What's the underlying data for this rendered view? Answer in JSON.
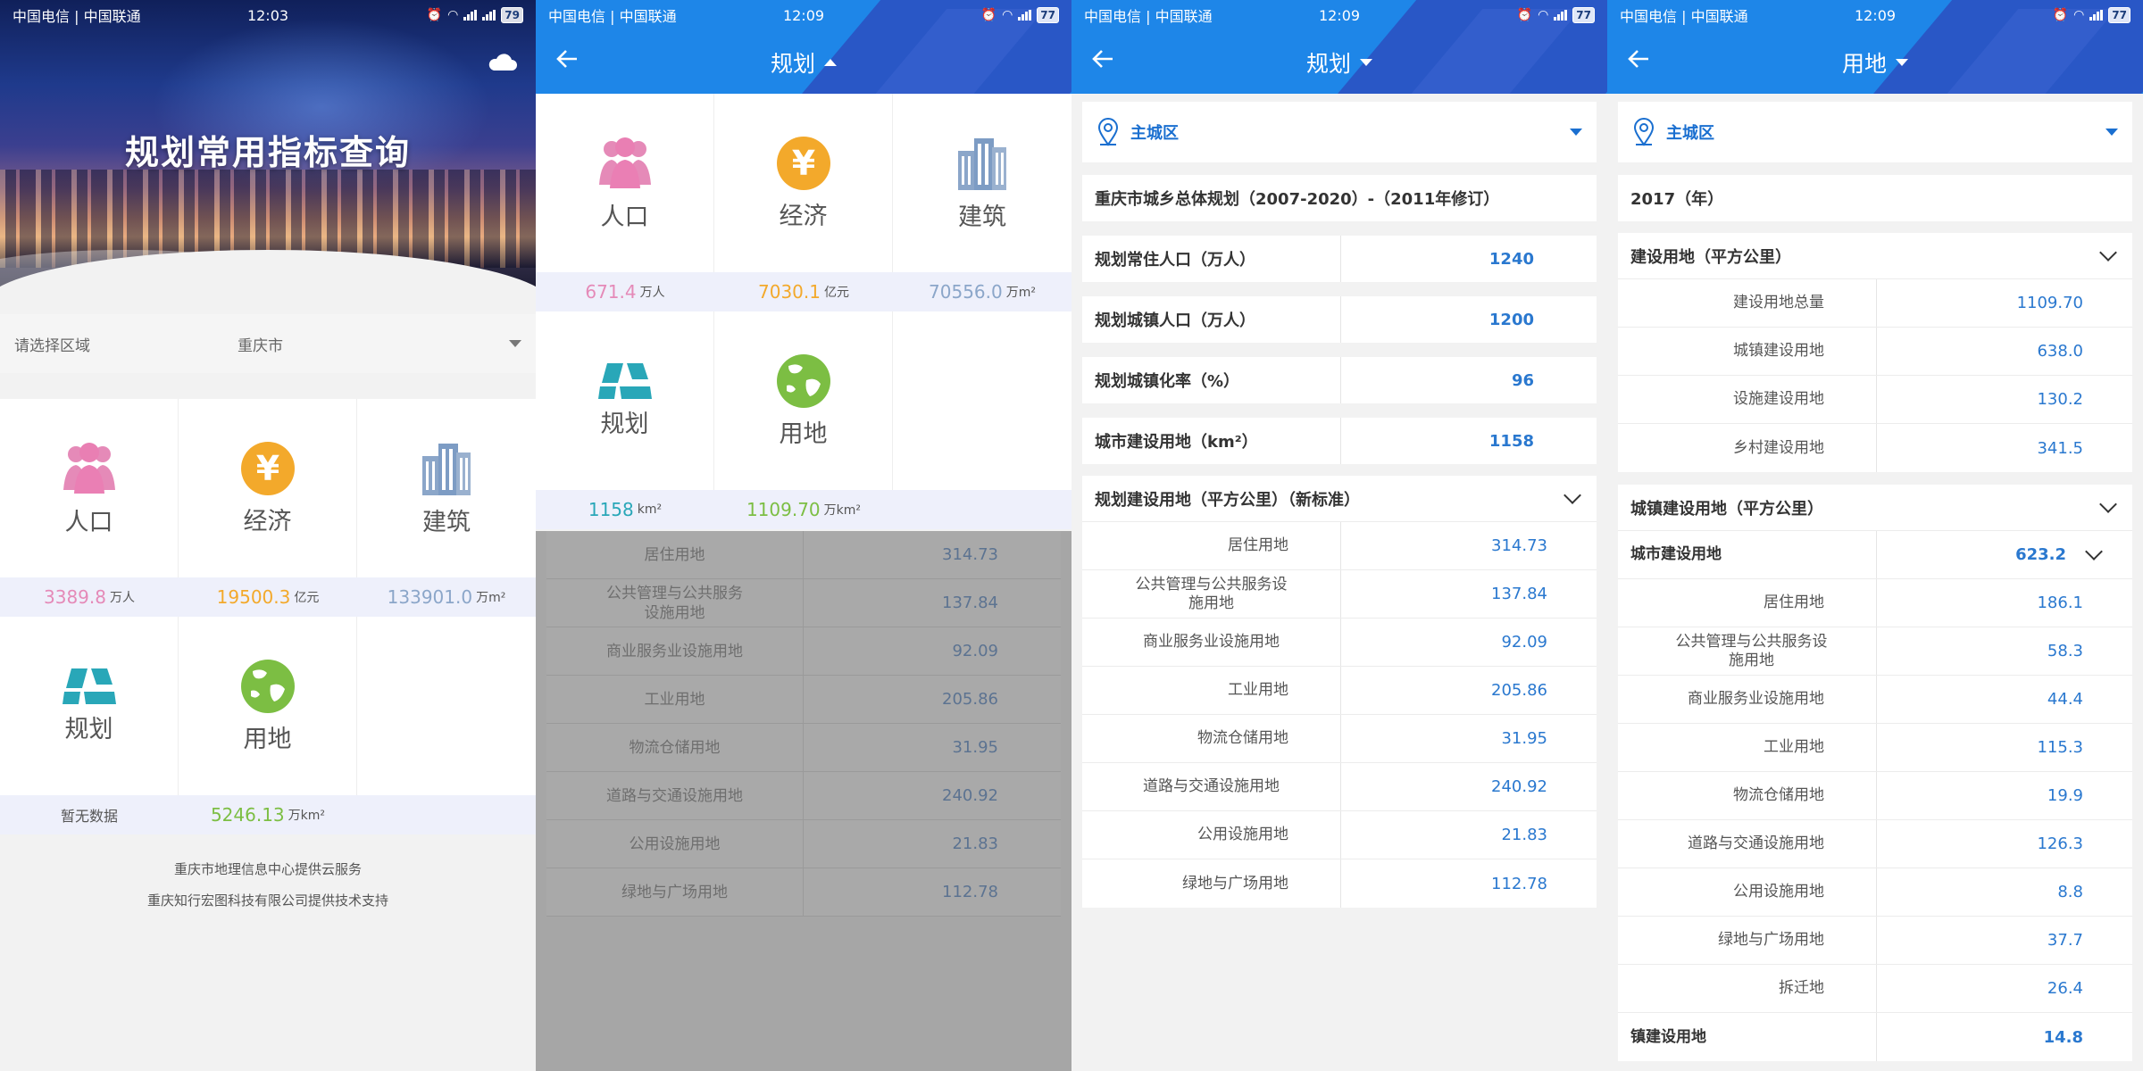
{
  "status_bars": [
    {
      "carrier": "中国电信 | 中国联通",
      "time": "12:03",
      "battery": "79"
    },
    {
      "carrier": "中国电信 | 中国联通",
      "time": "12:09",
      "battery": "77"
    },
    {
      "carrier": "中国电信 | 中国联通",
      "time": "12:09",
      "battery": "77"
    },
    {
      "carrier": "中国电信 | 中国联通",
      "time": "12:09",
      "battery": "77"
    }
  ],
  "home": {
    "title": "规划常用指标查询",
    "region_label": "请选择区域",
    "region_value": "重庆市",
    "tiles": [
      {
        "name": "人口",
        "value": "3389.8",
        "unit": "万人",
        "color": "#e58ab8"
      },
      {
        "name": "经济",
        "value": "19500.3",
        "unit": "亿元",
        "color": "#f3a92b"
      },
      {
        "name": "建筑",
        "value": "133901.0",
        "unit": "万m²",
        "color": "#8ba6c9"
      },
      {
        "name": "规划",
        "value": "暂无数据",
        "unit": "",
        "color": "#29a7b8"
      },
      {
        "name": "用地",
        "value": "5246.13",
        "unit": "万km²",
        "color": "#7cbe43"
      }
    ],
    "footer": [
      "重庆市地理信息中心提供云服务",
      "重庆知行宏图科技有限公司提供技术支持"
    ]
  },
  "menu": {
    "title": "规划",
    "tiles": [
      {
        "name": "人口",
        "value": "671.4",
        "unit": "万人",
        "color": "#e58ab8"
      },
      {
        "name": "经济",
        "value": "7030.1",
        "unit": "亿元",
        "color": "#f3a92b"
      },
      {
        "name": "建筑",
        "value": "70556.0",
        "unit": "万m²",
        "color": "#8ba6c9"
      },
      {
        "name": "规划",
        "value": "1158",
        "unit": "km²",
        "color": "#29a7b8"
      },
      {
        "name": "用地",
        "value": "1109.70",
        "unit": "万km²",
        "color": "#7cbe43"
      }
    ]
  },
  "land_rows": [
    {
      "name": "居住用地",
      "value": "314.73"
    },
    {
      "name": "公共管理与公共服务设施用地",
      "value": "137.84"
    },
    {
      "name": "商业服务业设施用地",
      "value": "92.09"
    },
    {
      "name": "工业用地",
      "value": "205.86"
    },
    {
      "name": "物流仓储用地",
      "value": "31.95"
    },
    {
      "name": "道路与交通设施用地",
      "value": "240.92"
    },
    {
      "name": "公用设施用地",
      "value": "21.83"
    },
    {
      "name": "绿地与广场用地",
      "value": "112.78"
    }
  ],
  "plan": {
    "title": "规划",
    "district": "主城区",
    "doc": "重庆市城乡总体规划（2007-2020）-（2011年修订）",
    "kv": [
      {
        "label": "规划常住人口（万人）",
        "value": "1240"
      },
      {
        "label": "规划城镇人口（万人）",
        "value": "1200"
      },
      {
        "label": "规划城镇化率（%）",
        "value": "96"
      },
      {
        "label": "城市建设用地（km²）",
        "value": "1158"
      }
    ],
    "section": "规划建设用地（平方公里）（新标准）"
  },
  "landuse": {
    "title": "用地",
    "district": "主城区",
    "year": "2017（年）",
    "section1": "建设用地（平方公里）",
    "rows1": [
      {
        "name": "建设用地总量",
        "value": "1109.70"
      },
      {
        "name": "城镇建设用地",
        "value": "638.0"
      },
      {
        "name": "设施建设用地",
        "value": "130.2"
      },
      {
        "name": "乡村建设用地",
        "value": "341.5"
      }
    ],
    "section2": "城镇建设用地（平方公里）",
    "city_label": "城市建设用地",
    "city_value": "623.2",
    "rows2": [
      {
        "name": "居住用地",
        "value": "186.1"
      },
      {
        "name": "公共管理与公共服务设施用地",
        "value": "58.3"
      },
      {
        "name": "商业服务业设施用地",
        "value": "44.4"
      },
      {
        "name": "工业用地",
        "value": "115.3"
      },
      {
        "name": "物流仓储用地",
        "value": "19.9"
      },
      {
        "name": "道路与交通设施用地",
        "value": "126.3"
      },
      {
        "name": "公用设施用地",
        "value": "8.8"
      },
      {
        "name": "绿地与广场用地",
        "value": "37.7"
      },
      {
        "name": "拆迁地",
        "value": "26.4"
      }
    ],
    "town_label": "镇建设用地",
    "town_value": "14.8"
  }
}
